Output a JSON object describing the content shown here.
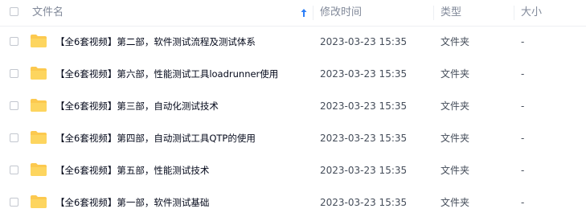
{
  "header": {
    "name_label": "文件名",
    "sort_icon": "sort-ascending-arrow-icon",
    "time_label": "修改时间",
    "type_label": "类型",
    "size_label": "大小"
  },
  "colors": {
    "header_text": "#818999",
    "sort_arrow": "#2f80f7",
    "folder": "#fcc94f",
    "name_text": "#03081a",
    "meta_text": "#454d5a"
  },
  "rows": [
    {
      "icon": "folder-icon",
      "name": "【全6套视频】第二部，软件测试流程及测试体系",
      "modified": "2023-03-23 15:35",
      "type": "文件夹",
      "size": "-"
    },
    {
      "icon": "folder-icon",
      "name": "【全6套视频】第六部，性能测试工具loadrunner使用",
      "modified": "2023-03-23 15:35",
      "type": "文件夹",
      "size": "-"
    },
    {
      "icon": "folder-icon",
      "name": "【全6套视频】第三部，自动化测试技术",
      "modified": "2023-03-23 15:35",
      "type": "文件夹",
      "size": "-"
    },
    {
      "icon": "folder-icon",
      "name": "【全6套视频】第四部，自动测试工具QTP的使用",
      "modified": "2023-03-23 15:35",
      "type": "文件夹",
      "size": "-"
    },
    {
      "icon": "folder-icon",
      "name": "【全6套视频】第五部，性能测试技术",
      "modified": "2023-03-23 15:35",
      "type": "文件夹",
      "size": "-"
    },
    {
      "icon": "folder-icon",
      "name": "【全6套视频】第一部，软件测试基础",
      "modified": "2023-03-23 15:35",
      "type": "文件夹",
      "size": "-"
    }
  ]
}
